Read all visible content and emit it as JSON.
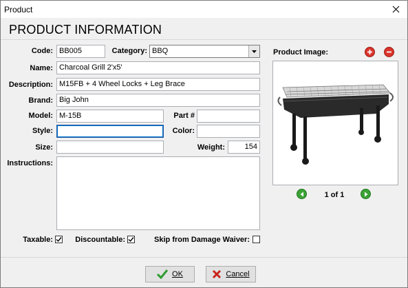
{
  "window": {
    "title": "Product"
  },
  "header": {
    "title": "PRODUCT INFORMATION"
  },
  "form": {
    "code": {
      "label": "Code:",
      "value": "BB005"
    },
    "category": {
      "label": "Category:",
      "value": "BBQ"
    },
    "name": {
      "label": "Name:",
      "value": "Charcoal Grill 2'x5'"
    },
    "description": {
      "label": "Description:",
      "value": "M15FB + 4 Wheel Locks + Leg Brace"
    },
    "brand": {
      "label": "Brand:",
      "value": "Big John"
    },
    "model": {
      "label": "Model:",
      "value": "M-15B"
    },
    "part": {
      "label": "Part #",
      "value": ""
    },
    "style": {
      "label": "Style:",
      "value": ""
    },
    "color": {
      "label": "Color:",
      "value": ""
    },
    "size": {
      "label": "Size:",
      "value": ""
    },
    "weight": {
      "label": "Weight:",
      "value": "154"
    },
    "instructions": {
      "label": "Instructions:",
      "value": ""
    },
    "taxable": {
      "label": "Taxable:",
      "checked": true
    },
    "discountable": {
      "label": "Discountable:",
      "checked": true
    },
    "skip_damage_waiver": {
      "label": "Skip from Damage Waiver:",
      "checked": false
    }
  },
  "image_panel": {
    "label": "Product Image:",
    "pager": "1 of 1",
    "add_icon": "add-circle-icon",
    "remove_icon": "remove-circle-icon"
  },
  "buttons": {
    "ok": {
      "label": "OK"
    },
    "cancel": {
      "label": "Cancel"
    }
  },
  "colors": {
    "add_red": "#d9342b",
    "nav_green": "#3aa335",
    "ok_check": "#2e9b2e",
    "cancel_x": "#c8231b"
  }
}
